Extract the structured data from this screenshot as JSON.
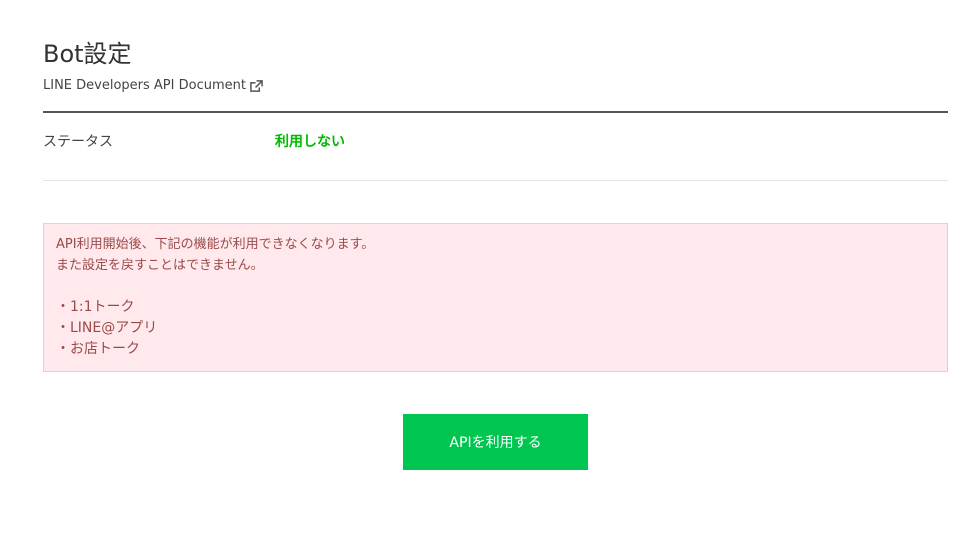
{
  "header": {
    "title": "Bot設定",
    "doc_link_label": "LINE Developers API Document",
    "doc_link_icon": "external-link-icon"
  },
  "status": {
    "label": "ステータス",
    "value": "利用しない",
    "value_color": "#00b900"
  },
  "alert": {
    "line1": "API利用開始後、下記の機能が利用できなくなります。",
    "line2": "また設定を戻すことはできません。",
    "bullet": "・",
    "items": [
      "1:1トーク",
      "LINE@アプリ",
      "お店トーク"
    ],
    "background": "#ffe9ec",
    "text_color": "#9b4a4a"
  },
  "action": {
    "button_label": "APIを利用する",
    "button_color": "#00c651"
  }
}
